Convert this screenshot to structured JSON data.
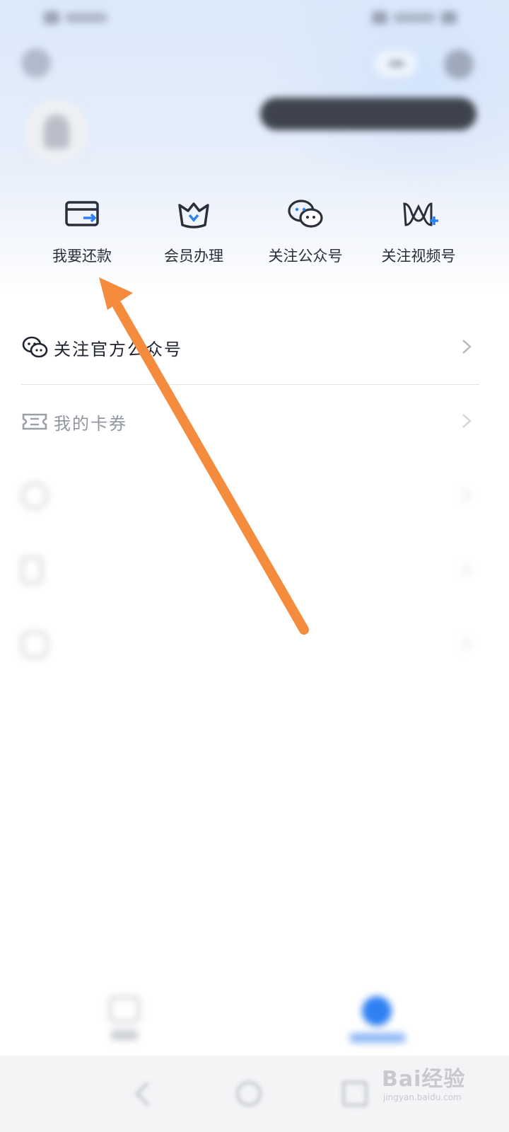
{
  "status_bar": {
    "left_text": "",
    "right_text": ""
  },
  "header": {
    "settings_icon": "gear-icon",
    "message_icon": "message-icon",
    "more_icon": "more-icon"
  },
  "profile": {
    "name": "",
    "phone": "",
    "pill_text": ""
  },
  "quick_actions": [
    {
      "label": "我要还款",
      "icon": "repay-card-icon"
    },
    {
      "label": "会员办理",
      "icon": "member-crown-icon"
    },
    {
      "label": "关注公众号",
      "icon": "wechat-icon"
    },
    {
      "label": "关注视频号",
      "icon": "video-channel-icon"
    }
  ],
  "list": [
    {
      "label": "关注官方公众号",
      "icon": "wechat-icon"
    },
    {
      "label": "我的卡券",
      "icon": "coupon-icon"
    },
    {
      "label": "",
      "icon": "help-icon"
    },
    {
      "label": "",
      "icon": "phone-icon"
    },
    {
      "label": "",
      "icon": "chat-icon"
    }
  ],
  "bottom_nav": [
    {
      "label": "",
      "icon": "home-icon"
    },
    {
      "label": "",
      "icon": "mine-icon"
    }
  ],
  "watermark": {
    "logo": "Bai经验",
    "url": "jingyan.baidu.com"
  },
  "colors": {
    "accent": "#2f80f2",
    "arrow": "#f58b3c",
    "text_primary": "#1f2430"
  }
}
